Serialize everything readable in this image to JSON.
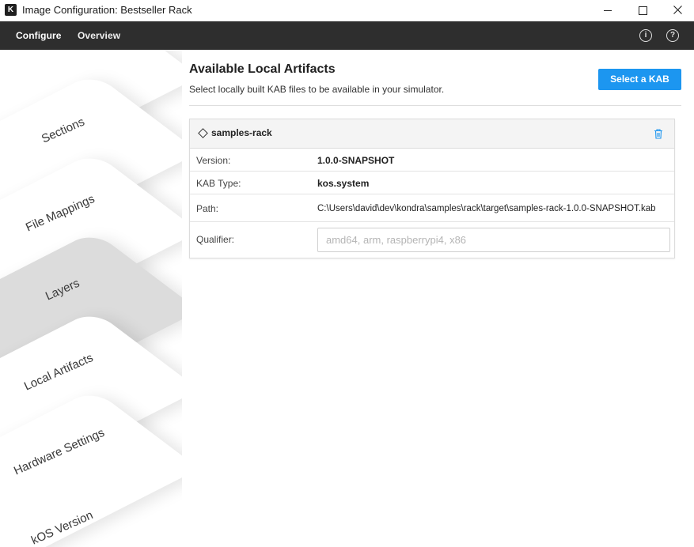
{
  "window": {
    "app_icon_letter": "K",
    "title": "Image Configuration: Bestseller Rack"
  },
  "menubar": {
    "configure": "Configure",
    "overview": "Overview",
    "info_icon": "i",
    "help_icon": "?"
  },
  "sidebar": {
    "items": [
      {
        "label": "Sections",
        "active": false
      },
      {
        "label": "File Mappings",
        "active": false
      },
      {
        "label": "Layers",
        "active": false
      },
      {
        "label": "Local Artifacts",
        "active": true
      },
      {
        "label": "Hardware Settings",
        "active": false
      },
      {
        "label": "kOS Version",
        "active": false
      }
    ]
  },
  "main": {
    "title": "Available Local Artifacts",
    "subtitle": "Select locally built KAB files to be available in your simulator.",
    "select_button": "Select a KAB",
    "accent_color": "#1c96f0"
  },
  "artifact": {
    "name": "samples-rack",
    "version_label": "Version:",
    "version_value": "1.0.0-SNAPSHOT",
    "kab_type_label": "KAB Type:",
    "kab_type_value": "kos.system",
    "path_label": "Path:",
    "path_value": "C:\\Users\\david\\dev\\kondra\\samples\\rack\\target\\samples-rack-1.0.0-SNAPSHOT.kab",
    "qualifier_label": "Qualifier:",
    "qualifier_value": "",
    "qualifier_placeholder": "amd64, arm, raspberrypi4, x86"
  }
}
